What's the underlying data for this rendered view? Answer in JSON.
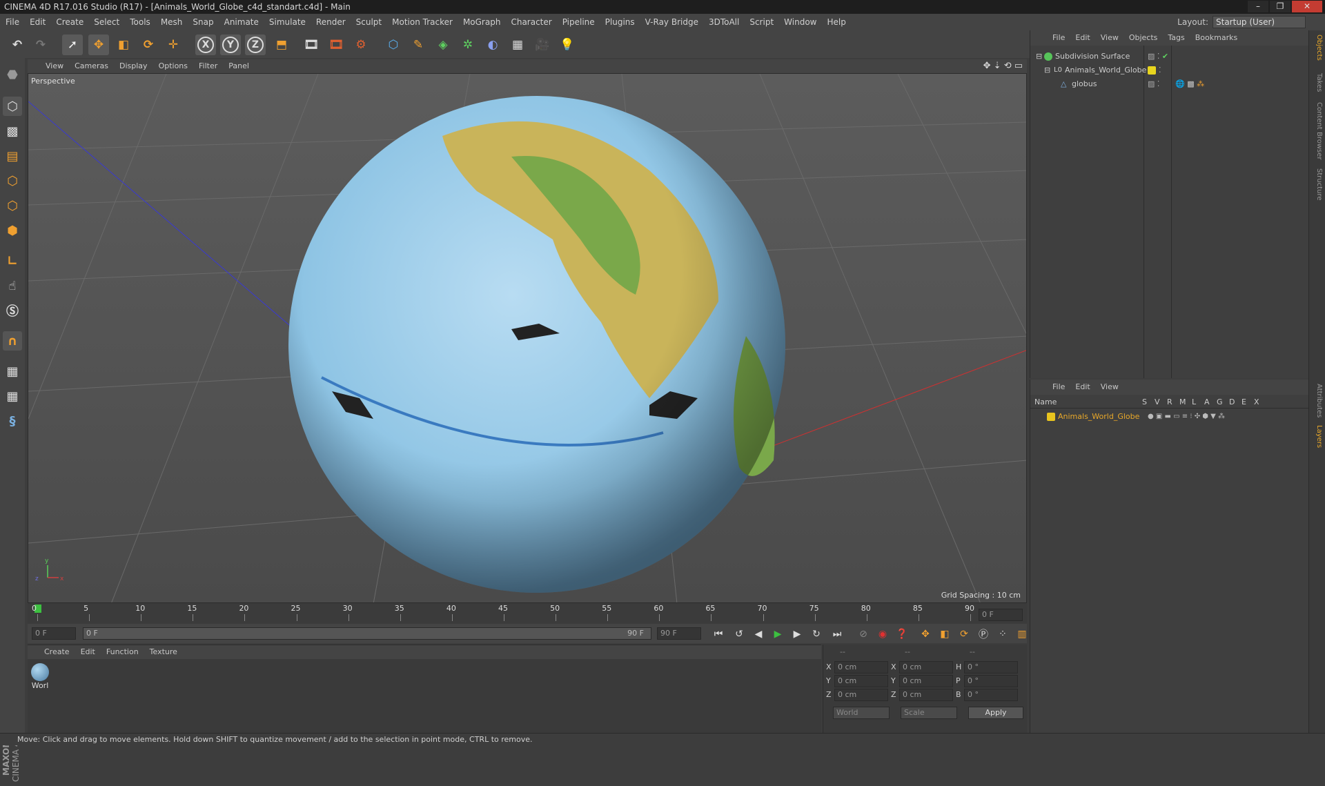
{
  "app": {
    "title": "CINEMA 4D R17.016 Studio (R17) - [Animals_World_Globe_c4d_standart.c4d] - Main",
    "window_buttons": [
      "–",
      "❐",
      "✕"
    ]
  },
  "menubar": [
    "File",
    "Edit",
    "Create",
    "Select",
    "Tools",
    "Mesh",
    "Snap",
    "Animate",
    "Simulate",
    "Render",
    "Sculpt",
    "Motion Tracker",
    "MoGraph",
    "Character",
    "Pipeline",
    "Plugins",
    "V-Ray Bridge",
    "3DToAll",
    "Script",
    "Window",
    "Help"
  ],
  "layout": {
    "label": "Layout:",
    "value": "Startup (User)"
  },
  "toolbar": {
    "axis_x": "X",
    "axis_y": "Y",
    "axis_z": "Z"
  },
  "viewport": {
    "menu": [
      "View",
      "Cameras",
      "Display",
      "Options",
      "Filter",
      "Panel"
    ],
    "label": "Perspective",
    "grid_spacing": "Grid Spacing : 10 cm",
    "axis_y": "y",
    "axis_z": "z",
    "axis_x": "x"
  },
  "timeline": {
    "ticks": [
      "0",
      "5",
      "10",
      "15",
      "20",
      "25",
      "30",
      "35",
      "40",
      "45",
      "50",
      "55",
      "60",
      "65",
      "70",
      "75",
      "80",
      "85",
      "90"
    ],
    "current_frame": "0 F"
  },
  "transport": {
    "start_field": "0 F",
    "range_start": "0 F",
    "range_end": "90 F",
    "end_field": "90 F"
  },
  "material_manager": {
    "menu": [
      "Create",
      "Edit",
      "Function",
      "Texture"
    ],
    "materials": [
      {
        "name": "Worl"
      }
    ]
  },
  "coords": {
    "headers": [
      "--",
      "--",
      "--"
    ],
    "rows": [
      {
        "l1": "X",
        "v1": "0 cm",
        "l2": "X",
        "v2": "0 cm",
        "l3": "H",
        "v3": "0 °"
      },
      {
        "l1": "Y",
        "v1": "0 cm",
        "l2": "Y",
        "v2": "0 cm",
        "l3": "P",
        "v3": "0 °"
      },
      {
        "l1": "Z",
        "v1": "0 cm",
        "l2": "Z",
        "v2": "0 cm",
        "l3": "B",
        "v3": "0 °"
      }
    ],
    "mode": "World",
    "transform": "Scale",
    "apply": "Apply"
  },
  "object_manager": {
    "menu": [
      "File",
      "Edit",
      "View",
      "Objects",
      "Tags",
      "Bookmarks"
    ],
    "objects": [
      {
        "name": "Subdivision Surface",
        "color": "#57c45a"
      },
      {
        "name": "Animals_World_Globe",
        "color": "#e8d51e"
      },
      {
        "name": "globus",
        "color": "#7fb0e0"
      }
    ]
  },
  "layer_manager": {
    "menu": [
      "File",
      "Edit",
      "View"
    ],
    "columns": [
      "Name",
      "S",
      "V",
      "R",
      "M",
      "L",
      "A",
      "G",
      "D",
      "E",
      "X"
    ],
    "layers": [
      {
        "name": "Animals_World_Globe",
        "color": "#e8c41e"
      }
    ]
  },
  "right_tabs": [
    "Objects",
    "Takes",
    "Content Browser",
    "Structure",
    "Attributes",
    "Layers"
  ],
  "status": "Move: Click and drag to move elements. Hold down SHIFT to quantize movement / add to the selection in point mode, CTRL to remove.",
  "branding": {
    "maxon": "MAXON",
    "cinema": "CINEMA 4D"
  }
}
